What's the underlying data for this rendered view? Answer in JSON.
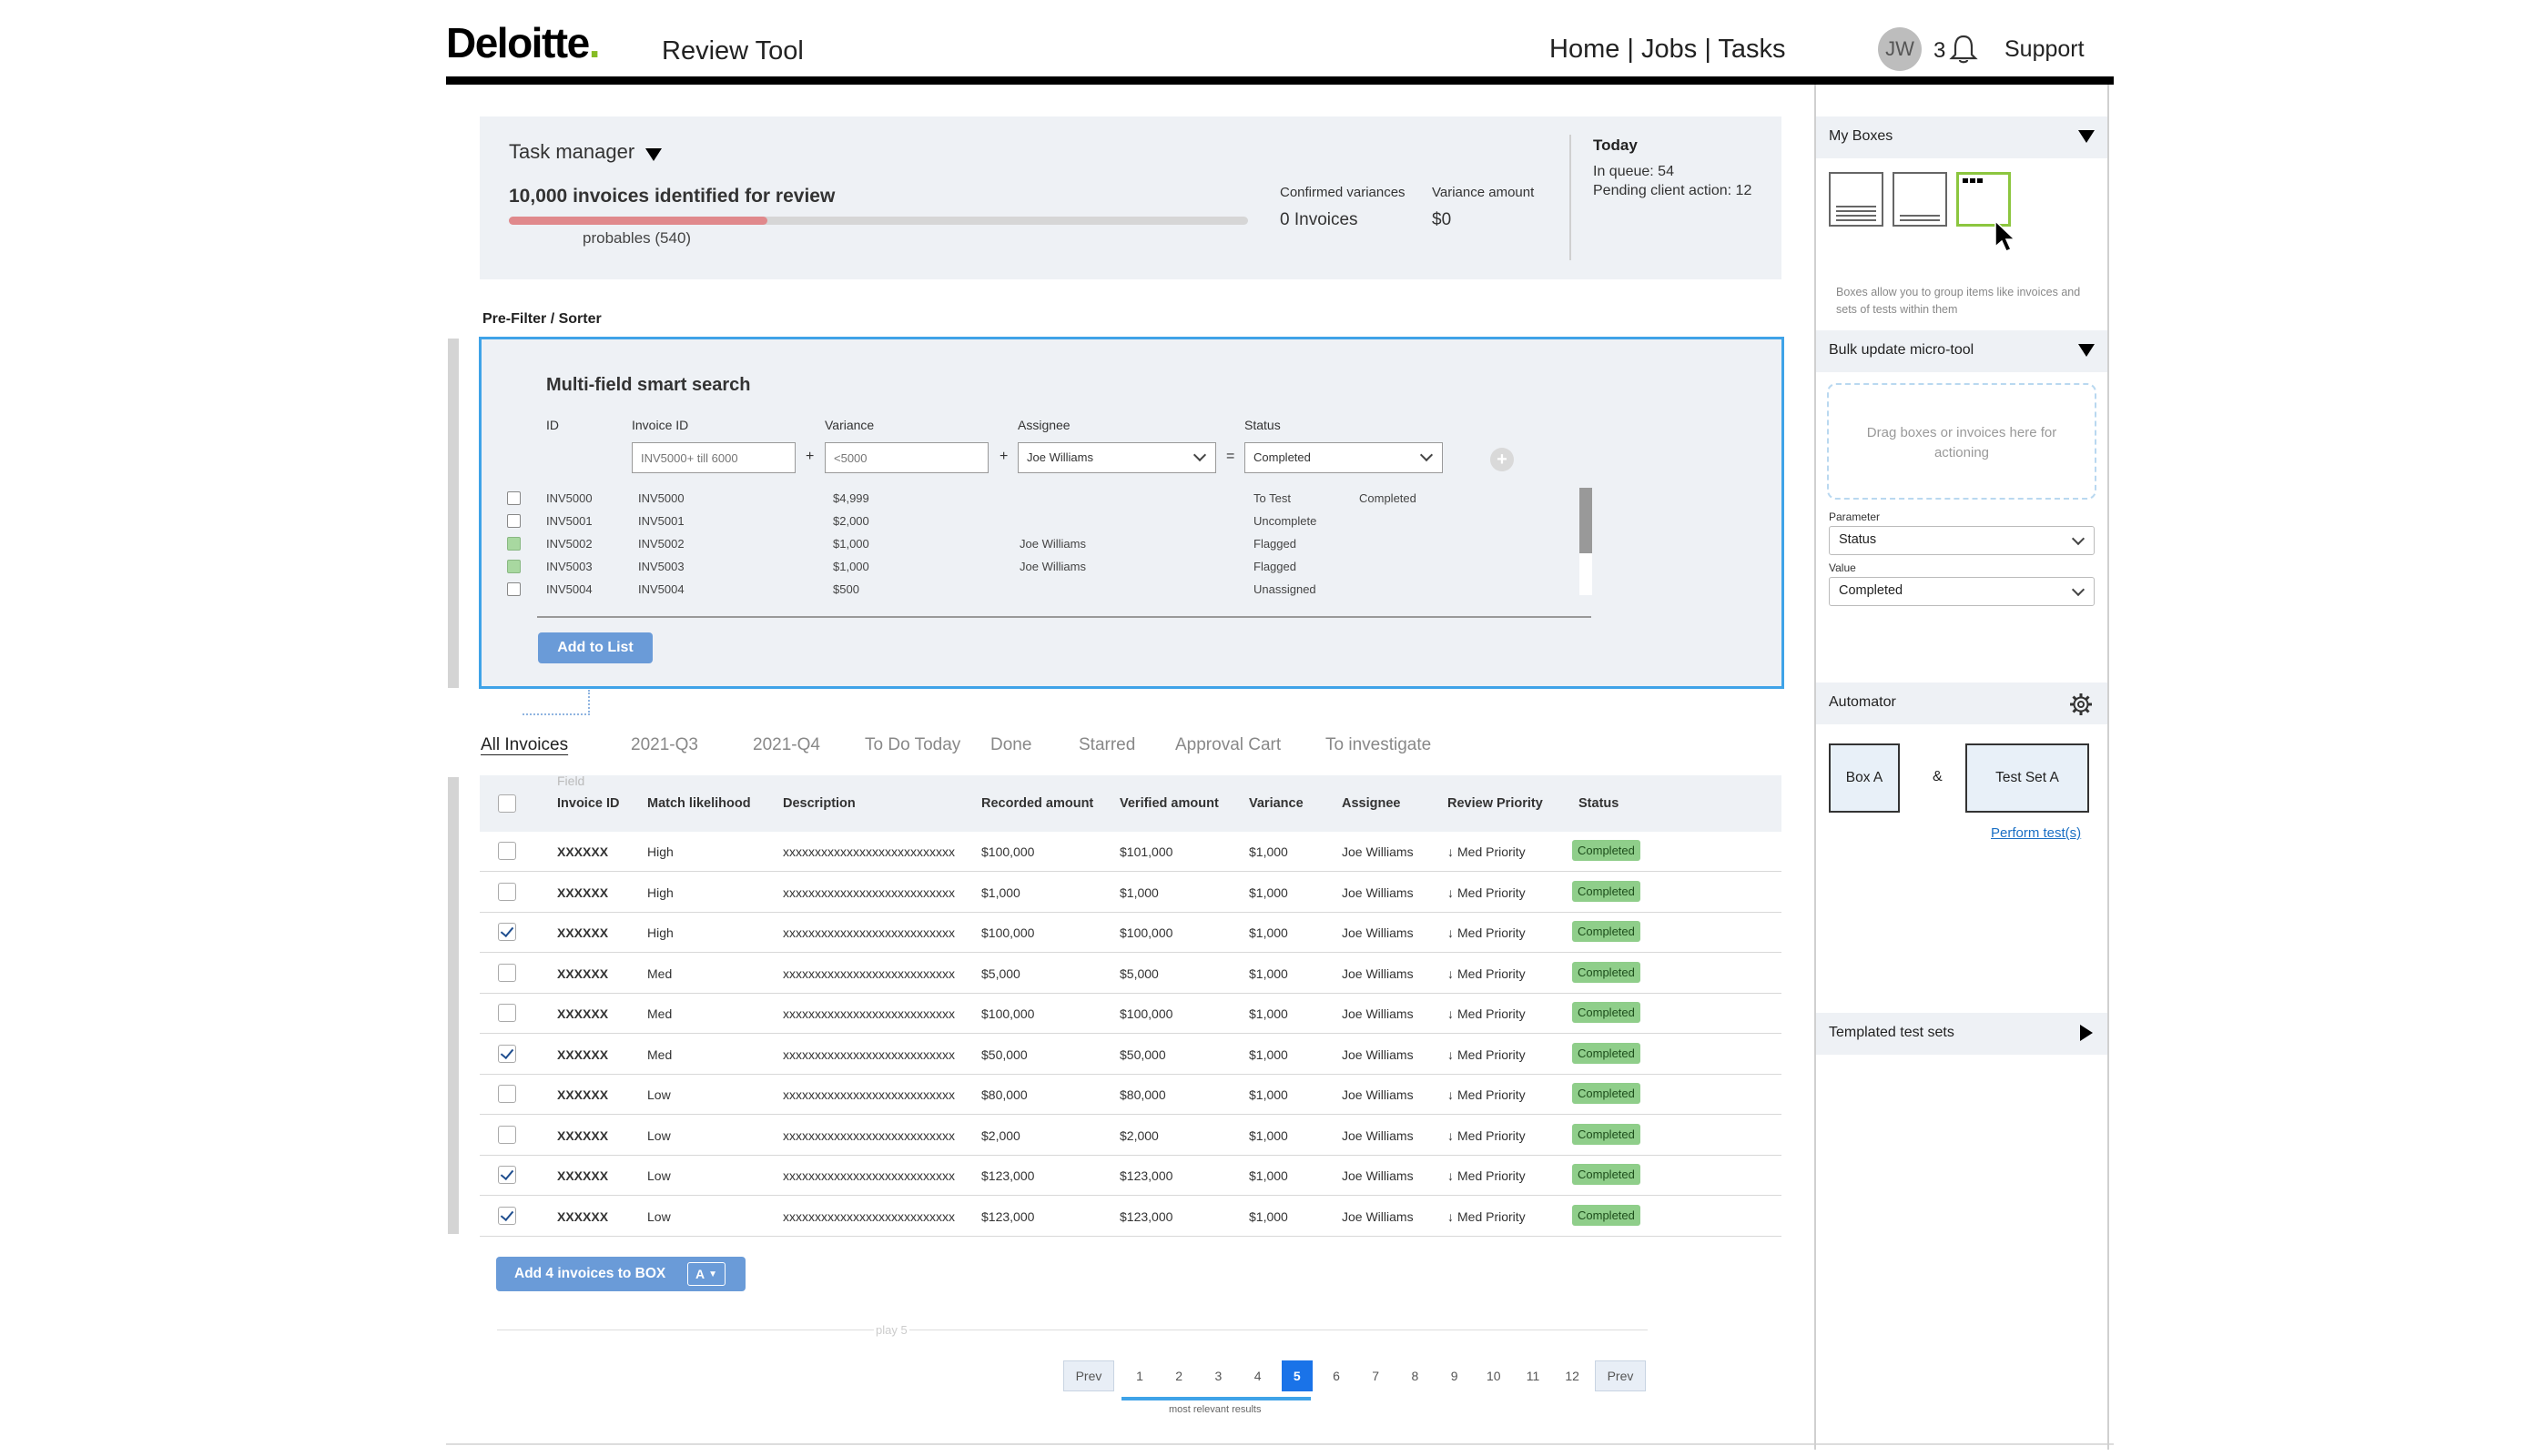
{
  "header": {
    "brand": "Deloitte",
    "brand_dot": ".",
    "app_title": "Review Tool",
    "nav": "Home | Jobs | Tasks",
    "avatar_initials": "JW",
    "notification_count": "3",
    "support": "Support"
  },
  "task_manager": {
    "title": "Task manager",
    "headline": "10,000 invoices identified for review",
    "progress_fraction": 0.35,
    "progress_label": "probables (540)",
    "confirmed_label": "Confirmed variances",
    "confirmed_value": "0 Invoices",
    "variance_label": "Variance amount",
    "variance_value": "$0",
    "today_title": "Today",
    "in_queue": "In queue: 54",
    "pending": "Pending client action: 12"
  },
  "prefilter": {
    "label": "Pre-Filter / Sorter",
    "search_title": "Multi-field smart search",
    "headers": [
      "ID",
      "Invoice ID",
      "Variance",
      "Assignee",
      "Status"
    ],
    "invoice_placeholder": "INV5000+ till 6000",
    "variance_placeholder": "<5000",
    "assignee_value": "Joe Williams",
    "status_value": "Completed",
    "op_plus": "+",
    "op_equals": "=",
    "add_circle": "+",
    "rows": [
      {
        "id": "INV5000",
        "invoice": "INV5000",
        "variance": "$4,999",
        "assignee": "",
        "status": "To Test",
        "extra": "Completed",
        "checked": false
      },
      {
        "id": "INV5001",
        "invoice": "INV5001",
        "variance": "$2,000",
        "assignee": "",
        "status": "Uncomplete",
        "extra": "",
        "checked": false
      },
      {
        "id": "INV5002",
        "invoice": "INV5002",
        "variance": "$1,000",
        "assignee": "Joe Williams",
        "status": "Flagged",
        "extra": "",
        "checked": true
      },
      {
        "id": "INV5003",
        "invoice": "INV5003",
        "variance": "$1,000",
        "assignee": "Joe Williams",
        "status": "Flagged",
        "extra": "",
        "checked": true
      },
      {
        "id": "INV5004",
        "invoice": "INV5004",
        "variance": "$500",
        "assignee": "",
        "status": "Unassigned",
        "extra": "",
        "checked": false
      }
    ],
    "add_button": "Add to List"
  },
  "tabs": [
    "All Invoices",
    "2021-Q3",
    "2021-Q4",
    "To Do Today",
    "Done",
    "Starred",
    "Approval Cart",
    "To investigate"
  ],
  "table": {
    "field_ghost": "Field",
    "columns": [
      "Invoice ID",
      "Match likelihood",
      "Description",
      "Recorded amount",
      "Verified amount",
      "Variance",
      "Assignee",
      "Review Priority",
      "Status"
    ],
    "rows": [
      {
        "checked": false,
        "id": "XXXXXX",
        "match": "High",
        "desc": "xxxxxxxxxxxxxxxxxxxxxxxxxxx",
        "recorded": "$100,000",
        "verified": "$101,000",
        "variance": "$1,000",
        "assignee": "Joe Williams",
        "priority": "Med Priority",
        "status": "Completed"
      },
      {
        "checked": false,
        "id": "XXXXXX",
        "match": "High",
        "desc": "xxxxxxxxxxxxxxxxxxxxxxxxxxx",
        "recorded": "$1,000",
        "verified": "$1,000",
        "variance": "$1,000",
        "assignee": "Joe Williams",
        "priority": "Med Priority",
        "status": "Completed"
      },
      {
        "checked": true,
        "id": "XXXXXX",
        "match": "High",
        "desc": "xxxxxxxxxxxxxxxxxxxxxxxxxxx",
        "recorded": "$100,000",
        "verified": "$100,000",
        "variance": "$1,000",
        "assignee": "Joe Williams",
        "priority": "Med Priority",
        "status": "Completed"
      },
      {
        "checked": false,
        "id": "XXXXXX",
        "match": "Med",
        "desc": "xxxxxxxxxxxxxxxxxxxxxxxxxxx",
        "recorded": "$5,000",
        "verified": "$5,000",
        "variance": "$1,000",
        "assignee": "Joe Williams",
        "priority": "Med Priority",
        "status": "Completed"
      },
      {
        "checked": false,
        "id": "XXXXXX",
        "match": "Med",
        "desc": "xxxxxxxxxxxxxxxxxxxxxxxxxxx",
        "recorded": "$100,000",
        "verified": "$100,000",
        "variance": "$1,000",
        "assignee": "Joe Williams",
        "priority": "Med Priority",
        "status": "Completed"
      },
      {
        "checked": true,
        "id": "XXXXXX",
        "match": "Med",
        "desc": "xxxxxxxxxxxxxxxxxxxxxxxxxxx",
        "recorded": "$50,000",
        "verified": "$50,000",
        "variance": "$1,000",
        "assignee": "Joe Williams",
        "priority": "Med Priority",
        "status": "Completed"
      },
      {
        "checked": false,
        "id": "XXXXXX",
        "match": "Low",
        "desc": "xxxxxxxxxxxxxxxxxxxxxxxxxxx",
        "recorded": "$80,000",
        "verified": "$80,000",
        "variance": "$1,000",
        "assignee": "Joe Williams",
        "priority": "Med Priority",
        "status": "Completed"
      },
      {
        "checked": false,
        "id": "XXXXXX",
        "match": "Low",
        "desc": "xxxxxxxxxxxxxxxxxxxxxxxxxxx",
        "recorded": "$2,000",
        "verified": "$2,000",
        "variance": "$1,000",
        "assignee": "Joe Williams",
        "priority": "Med Priority",
        "status": "Completed"
      },
      {
        "checked": true,
        "id": "XXXXXX",
        "match": "Low",
        "desc": "xxxxxxxxxxxxxxxxxxxxxxxxxxx",
        "recorded": "$123,000",
        "verified": "$123,000",
        "variance": "$1,000",
        "assignee": "Joe Williams",
        "priority": "Med Priority",
        "status": "Completed"
      },
      {
        "checked": true,
        "id": "XXXXXX",
        "match": "Low",
        "desc": "xxxxxxxxxxxxxxxxxxxxxxxxxxx",
        "recorded": "$123,000",
        "verified": "$123,000",
        "variance": "$1,000",
        "assignee": "Joe Williams",
        "priority": "Med Priority",
        "status": "Completed"
      }
    ],
    "add_to_box": "Add 4 invoices to BOX",
    "box_pick": "A"
  },
  "pagination": {
    "ghost": "play 5",
    "prev": "Prev",
    "next": "Prev",
    "pages": [
      "1",
      "2",
      "3",
      "4",
      "5",
      "6",
      "7",
      "8",
      "9",
      "10",
      "11",
      "12"
    ],
    "current": "5",
    "relevance_label": "most relevant results"
  },
  "right_panel": {
    "my_boxes": "My Boxes",
    "boxes_note": "Boxes allow you to group items like invoices and sets of tests within them",
    "bulk_title": "Bulk update micro-tool",
    "drop_text": "Drag boxes or invoices here for actioning",
    "parameter_label": "Parameter",
    "parameter_value": "Status",
    "value_label": "Value",
    "value_value": "Completed",
    "automator": "Automator",
    "box_a": "Box A",
    "amp": "&",
    "test_set": "Test Set A",
    "perform": "Perform test(s)",
    "templated": "Templated test sets"
  },
  "colors": {
    "accent": "#3fa3e8",
    "brand_green": "#86bc25",
    "button": "#6a9bd8",
    "status_green": "#8fce8a",
    "progress": "#e0898c"
  }
}
